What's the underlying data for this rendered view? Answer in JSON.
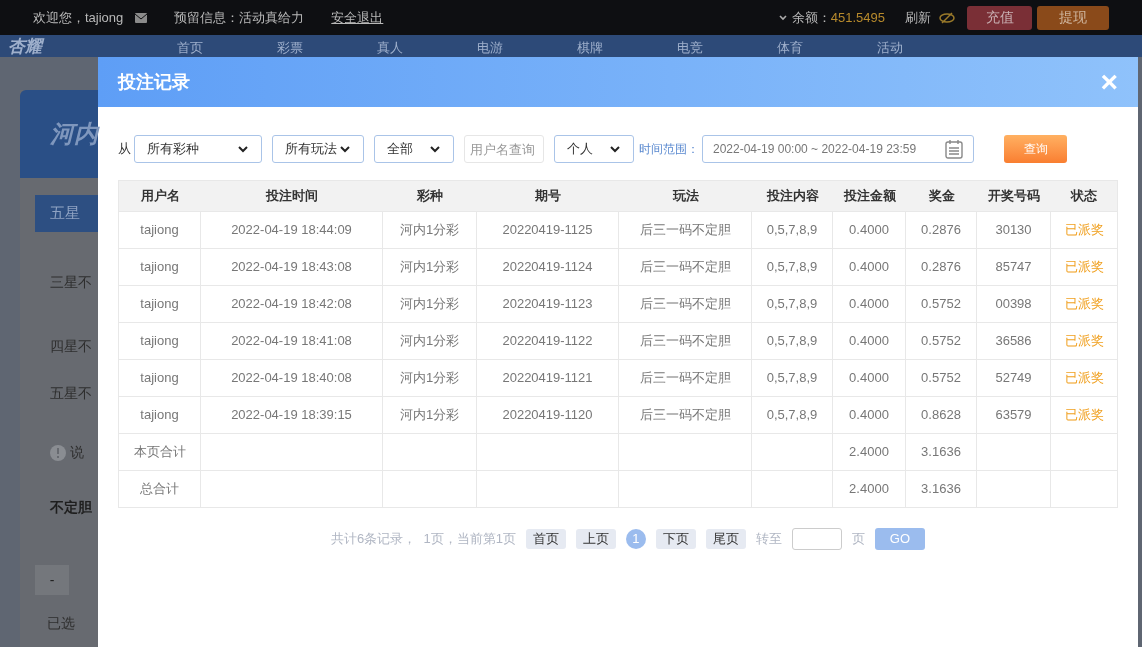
{
  "top_bar": {
    "welcome": "欢迎您，tajiong",
    "reserved_info": "预留信息：活动真给力",
    "logout": "安全退出",
    "balance_label": "余额：",
    "balance": "451.5495",
    "refresh": "刷新",
    "deposit": "充值",
    "withdraw": "提现"
  },
  "nav": {
    "logo": "杏耀",
    "items": [
      "首页",
      "彩票",
      "真人",
      "电游",
      "棋牌",
      "电竞",
      "体育",
      "活动"
    ]
  },
  "background": {
    "game_title": "河内",
    "tab": "五星",
    "rows": [
      "三星不",
      "四星不",
      "五星不"
    ],
    "note": "说",
    "section": "不定胆",
    "minus": "-",
    "selected_label": "已选"
  },
  "dialog": {
    "title": "投注记录",
    "close": "×",
    "filters": {
      "from_label": "从",
      "lottery": "所有彩种",
      "play": "所有玩法",
      "status": "全部",
      "username_placeholder": "用户名查询",
      "scope": "个人",
      "time_label": "时间范围：",
      "time_range": "2022-04-19 00:00 ~ 2022-04-19 23:59",
      "query": "查询"
    },
    "table": {
      "columns": [
        "用户名",
        "投注时间",
        "彩种",
        "期号",
        "玩法",
        "投注内容",
        "投注金额",
        "奖金",
        "开奖号码",
        "状态"
      ],
      "rows": [
        [
          "tajiong",
          "2022-04-19 18:44:09",
          "河内1分彩",
          "20220419-1125",
          "后三一码不定胆",
          "0,5,7,8,9",
          "0.4000",
          "0.2876",
          "30130",
          "已派奖"
        ],
        [
          "tajiong",
          "2022-04-19 18:43:08",
          "河内1分彩",
          "20220419-1124",
          "后三一码不定胆",
          "0,5,7,8,9",
          "0.4000",
          "0.2876",
          "85747",
          "已派奖"
        ],
        [
          "tajiong",
          "2022-04-19 18:42:08",
          "河内1分彩",
          "20220419-1123",
          "后三一码不定胆",
          "0,5,7,8,9",
          "0.4000",
          "0.5752",
          "00398",
          "已派奖"
        ],
        [
          "tajiong",
          "2022-04-19 18:41:08",
          "河内1分彩",
          "20220419-1122",
          "后三一码不定胆",
          "0,5,7,8,9",
          "0.4000",
          "0.5752",
          "36586",
          "已派奖"
        ],
        [
          "tajiong",
          "2022-04-19 18:40:08",
          "河内1分彩",
          "20220419-1121",
          "后三一码不定胆",
          "0,5,7,8,9",
          "0.4000",
          "0.5752",
          "52749",
          "已派奖"
        ],
        [
          "tajiong",
          "2022-04-19 18:39:15",
          "河内1分彩",
          "20220419-1120",
          "后三一码不定胆",
          "0,5,7,8,9",
          "0.4000",
          "0.8628",
          "63579",
          "已派奖"
        ]
      ],
      "totals": [
        {
          "label": "本页合计",
          "amount": "2.4000",
          "prize": "3.1636"
        },
        {
          "label": "总合计",
          "amount": "2.4000",
          "prize": "3.1636"
        }
      ]
    },
    "pagination": {
      "summary": "共计6条记录，  1页，当前第1页",
      "pages": [
        {
          "label": "首页",
          "kind": "nav"
        },
        {
          "label": "上页",
          "kind": "nav"
        },
        {
          "label": "1",
          "kind": "page",
          "selected": true
        },
        {
          "label": "下页",
          "kind": "nav"
        },
        {
          "label": "尾页",
          "kind": "nav"
        }
      ],
      "goto_label": "转至",
      "page_unit": "页",
      "go": "GO"
    }
  }
}
